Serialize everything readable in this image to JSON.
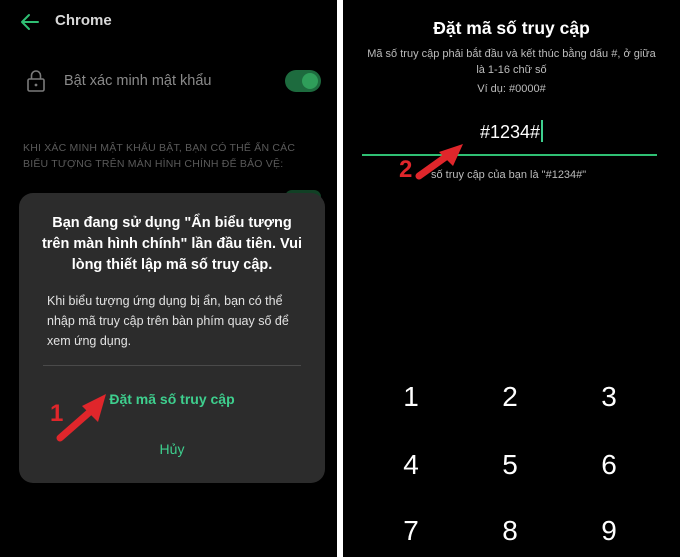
{
  "left": {
    "app_title": "Chrome",
    "setting_label": "Bật xác minh mật khẩu",
    "hint": "KHI XÁC MINH MẬT KHẨU BẬT, BẠN CÓ THỂ ẨN CÁC BIỂU TƯỢNG TRÊN MÀN HÌNH CHÍNH ĐỂ BẢO VỆ:",
    "dialog": {
      "title": "Bạn đang sử dụng \"Ẩn biểu tượng trên màn hình chính\" lần đầu tiên. Vui lòng thiết lập mã số truy cập.",
      "body": "Khi biểu tượng ứng dụng bị ẩn, bạn có thể nhập mã truy cập trên bàn phím quay số để xem ứng dụng.",
      "primary_button": "Đặt mã số truy cập",
      "cancel_button": "Hủy"
    },
    "annotation": "1"
  },
  "right": {
    "title": "Đặt mã số truy cập",
    "description": "Mã số truy cập phải bắt đầu và kết thúc bằng dấu #, ở giữa là 1-16 chữ số",
    "example": "Ví dụ: #0000#",
    "code_value": "#1234#",
    "confirm_text": "số truy cập của bạn là \"#1234#\"",
    "annotation": "2",
    "keypad": [
      "1",
      "2",
      "3",
      "4",
      "5",
      "6",
      "7",
      "8",
      "9"
    ]
  },
  "colors": {
    "accent": "#3ecf8e",
    "annotation": "#e0262b",
    "dialog_bg": "#2c2c2c"
  }
}
